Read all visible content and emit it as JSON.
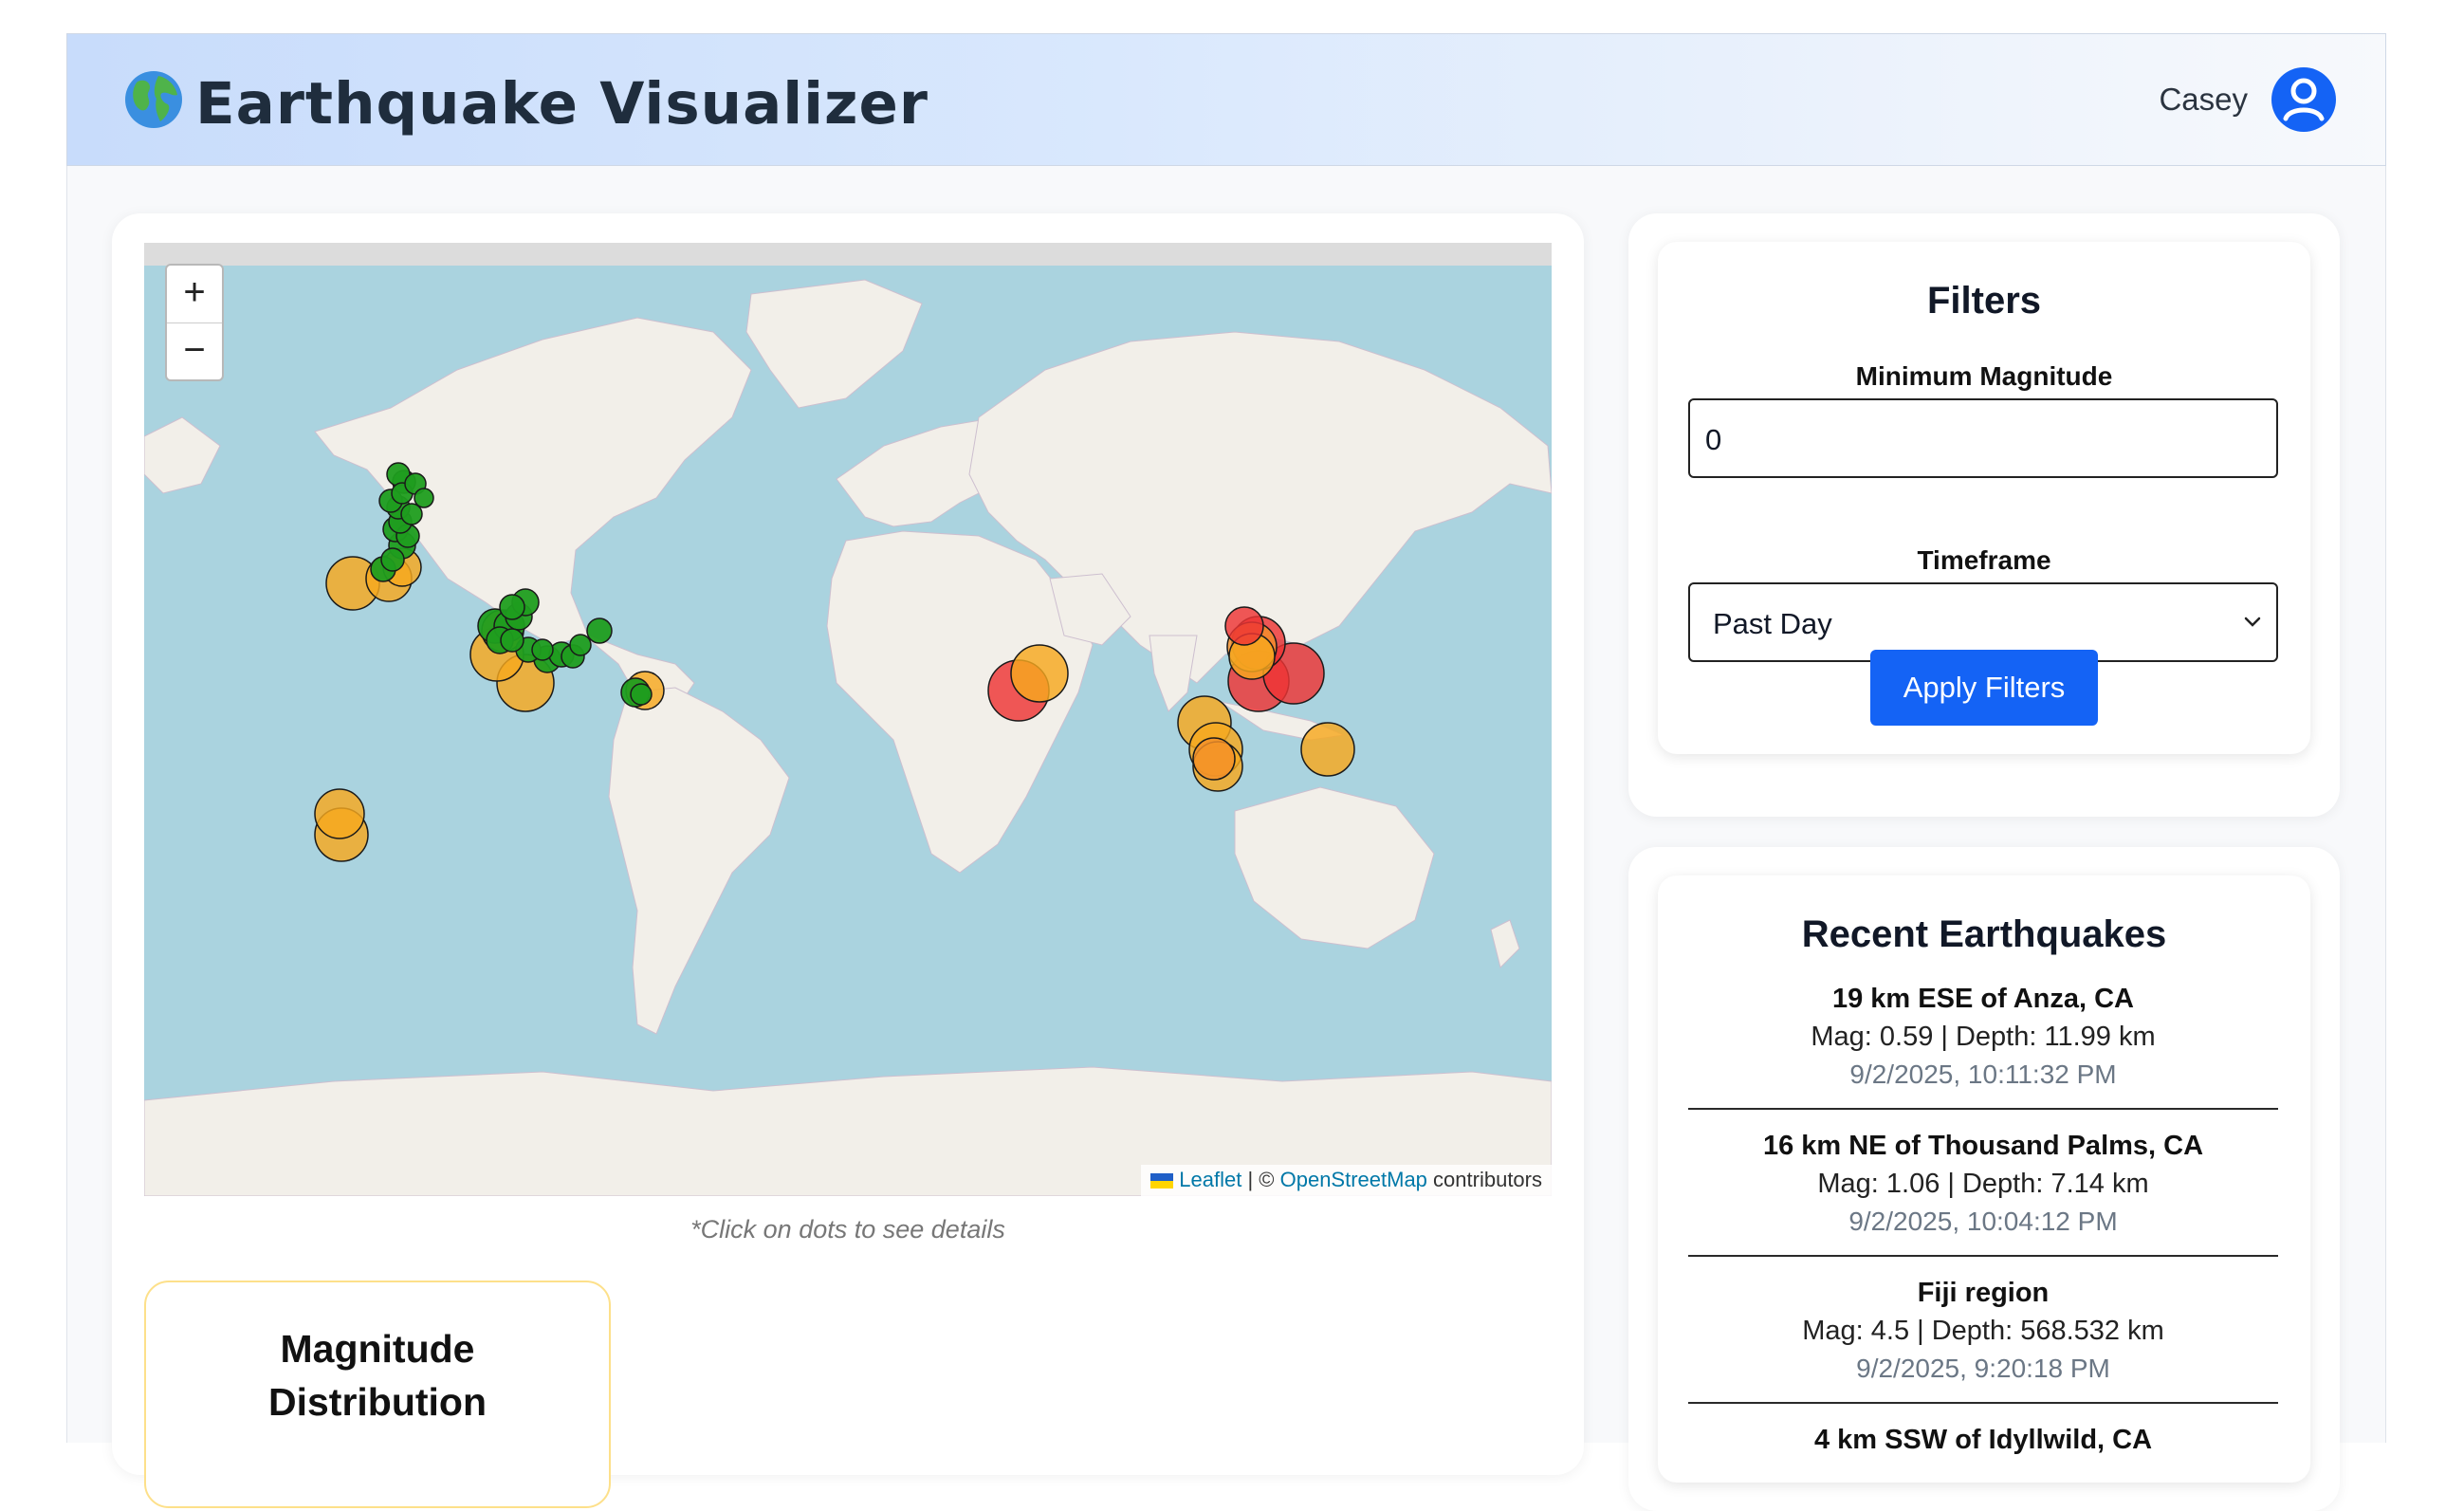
{
  "header": {
    "title": "Earthquake Visualizer",
    "user": "Casey"
  },
  "map": {
    "zoom_in": "+",
    "zoom_out": "−",
    "attribution": {
      "leaflet": "Leaflet",
      "separator": "| ©",
      "osm": "OpenStreetMap",
      "suffix": "contributors"
    },
    "hint": "*Click on dots to see details"
  },
  "distribution": {
    "title": "Magnitude Distribution"
  },
  "filters": {
    "title": "Filters",
    "min_magnitude_label": "Minimum Magnitude",
    "min_magnitude_value": "0",
    "timeframe_label": "Timeframe",
    "timeframe_value": "Past Day",
    "apply_label": "Apply Filters"
  },
  "recent": {
    "title": "Recent Earthquakes",
    "items": [
      {
        "place": "19 km ESE of Anza, CA",
        "meta": "Mag: 0.59 | Depth: 11.99 km",
        "time": "9/2/2025, 10:11:32 PM"
      },
      {
        "place": "16 km NE of Thousand Palms, CA",
        "meta": "Mag: 1.06 | Depth: 7.14 km",
        "time": "9/2/2025, 10:04:12 PM"
      },
      {
        "place": "Fiji region",
        "meta": "Mag: 4.5 | Depth: 568.532 km",
        "time": "9/2/2025, 9:20:18 PM"
      },
      {
        "place": "4 km SSW of Idyllwild, CA",
        "meta": "",
        "time": ""
      }
    ]
  },
  "colors": {
    "low": "#1f9d1f",
    "medium": "#f7a81e",
    "high": "#f4902a",
    "severe": "#ee3535",
    "ocean": "#aad3df",
    "land": "#f2efe9",
    "accent": "#1463f5"
  }
}
